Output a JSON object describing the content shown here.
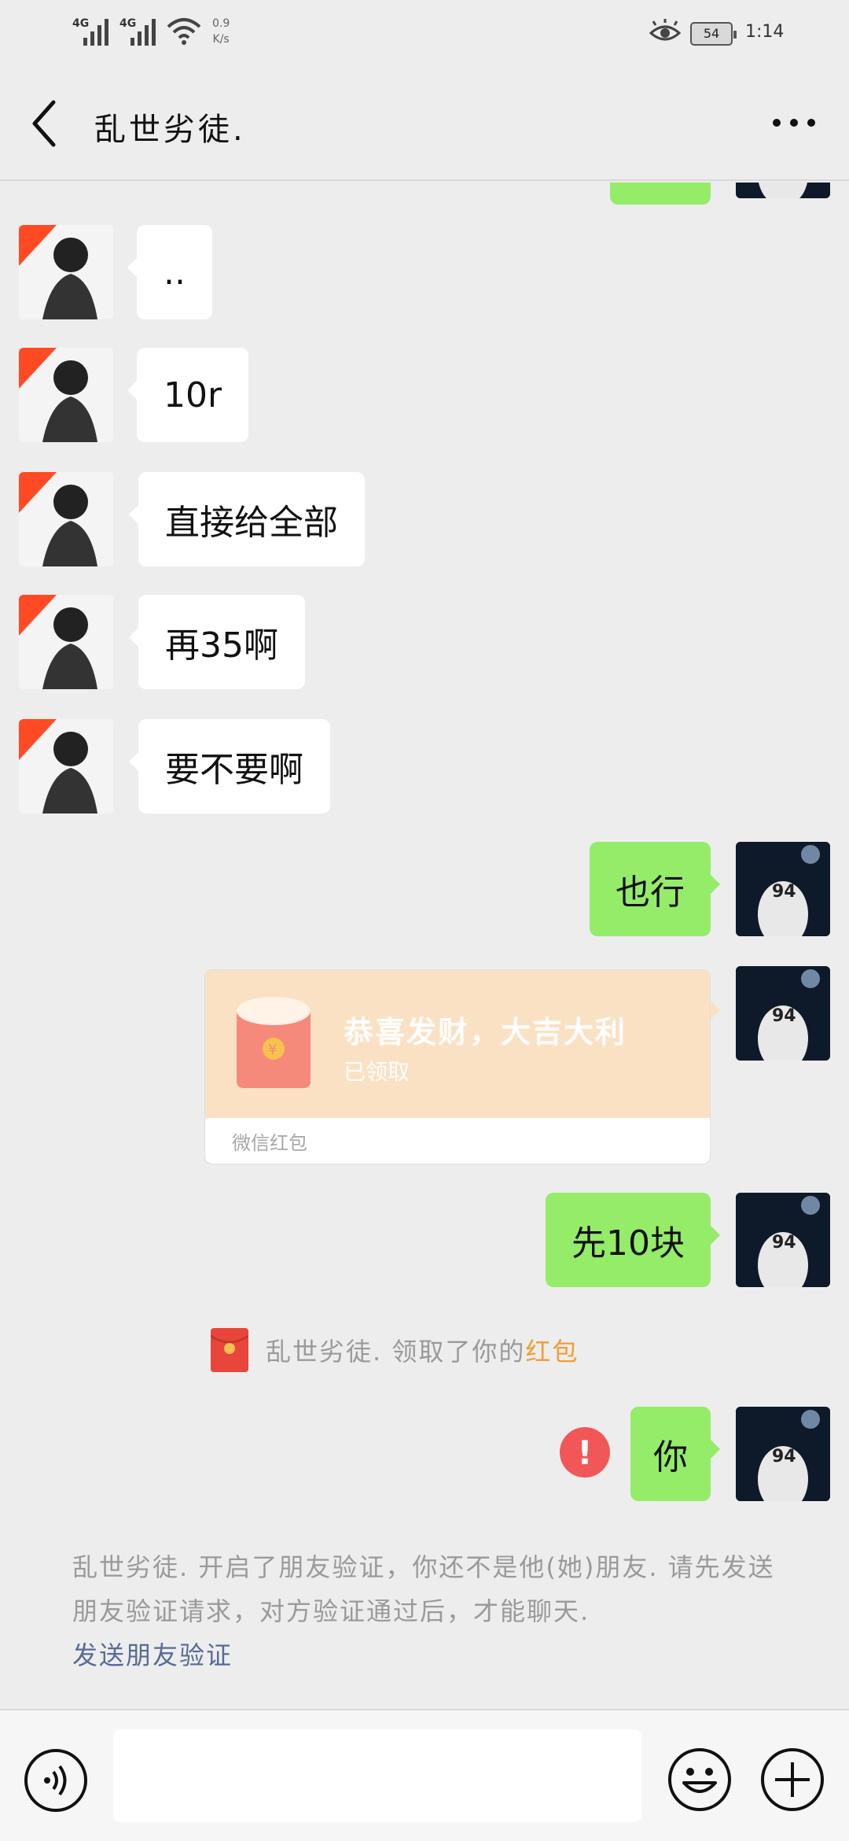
{
  "status_bar": {
    "signal1": "4G",
    "signal2": "4G",
    "speed_value": "0.9",
    "speed_unit": "K/s",
    "battery": "54",
    "time": "1:14"
  },
  "header": {
    "title": "乱世劣徒.",
    "back_icon": "chevron-left-icon",
    "more_icon": "more-dots-icon"
  },
  "messages": [
    {
      "side": "left",
      "text": ".."
    },
    {
      "side": "left",
      "text": "10r"
    },
    {
      "side": "left",
      "text": "直接给全部"
    },
    {
      "side": "left",
      "text": "再35啊"
    },
    {
      "side": "left",
      "text": "要不要啊"
    },
    {
      "side": "right",
      "text": "也行"
    },
    {
      "side": "right",
      "text": "先10块"
    },
    {
      "side": "right",
      "text": "你"
    }
  ],
  "red_packet": {
    "title": "恭喜发财，大吉大利",
    "status": "已领取",
    "footer": "微信红包"
  },
  "system_message": {
    "prefix": "乱世劣徒. 领取了你的",
    "highlight": "红包",
    "highlight_color": "#f39c33"
  },
  "friend_notice": {
    "text": "乱世劣徒. 开启了朋友验证，你还不是他(她)朋友. 请先发送朋友验证请求，对方验证通过后，才能聊天.",
    "link": "发送朋友验证",
    "link_color": "#576b95"
  },
  "input_bar": {
    "voice_icon": "voice-icon",
    "emoji_icon": "emoji-icon",
    "plus_icon": "plus-icon",
    "value": ""
  },
  "colors": {
    "background": "#ededed",
    "sent_bubble": "#95ec69",
    "received_bubble": "#ffffff",
    "error": "#f25757"
  }
}
